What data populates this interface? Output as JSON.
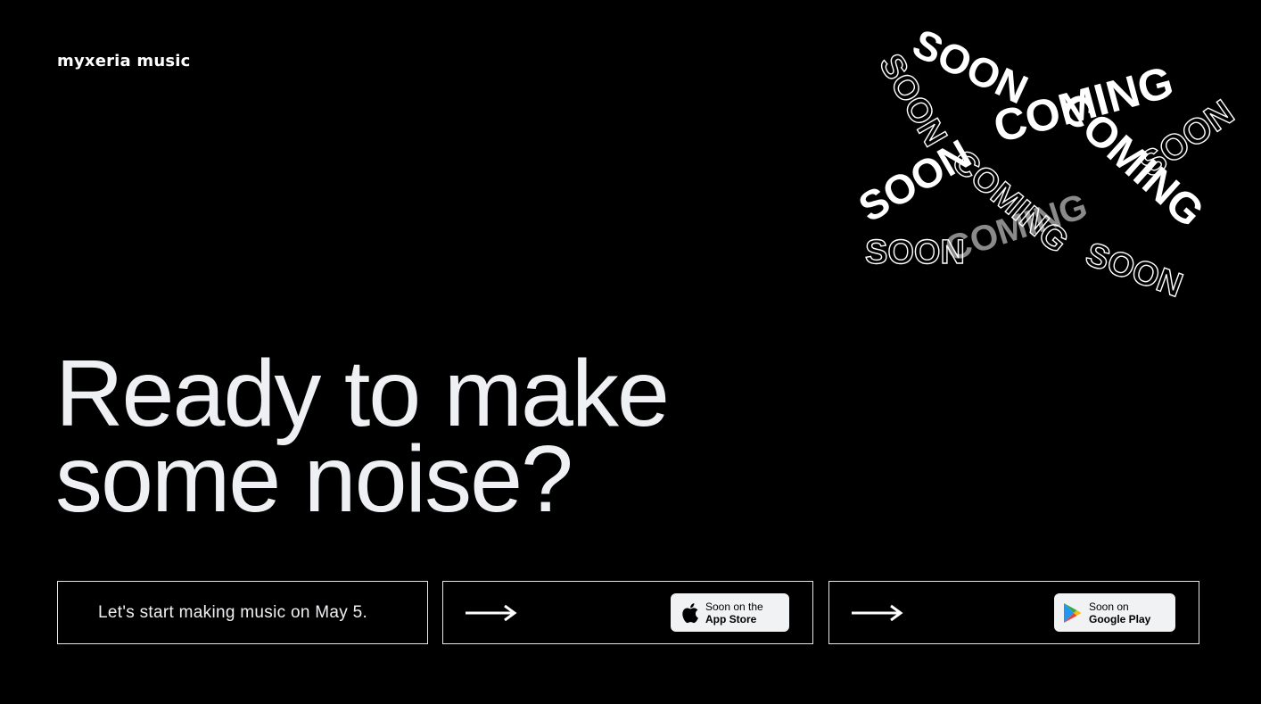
{
  "brand": {
    "name": "myxeria music"
  },
  "decoration": {
    "ribbon_words": [
      "SOON",
      "COMING",
      "SOON",
      "COMING",
      "SOON",
      "COMING",
      "SOON",
      "SOON"
    ]
  },
  "hero": {
    "line1": "Ready to make",
    "line2": "some noise?"
  },
  "cta": {
    "launch_text": "Let's start making music on May 5.",
    "app_store": {
      "line1": "Soon on the",
      "line2": "App Store",
      "icon": "apple-icon"
    },
    "google_play": {
      "line1": "Soon on",
      "line2": "Google Play",
      "icon": "google-play-icon"
    },
    "arrow_icon": "arrow-right-icon"
  },
  "colors": {
    "background": "#000000",
    "text": "#eef0f3",
    "ribbon_gray": "#8a8a8a",
    "badge_bg": "#f1f2f4"
  }
}
